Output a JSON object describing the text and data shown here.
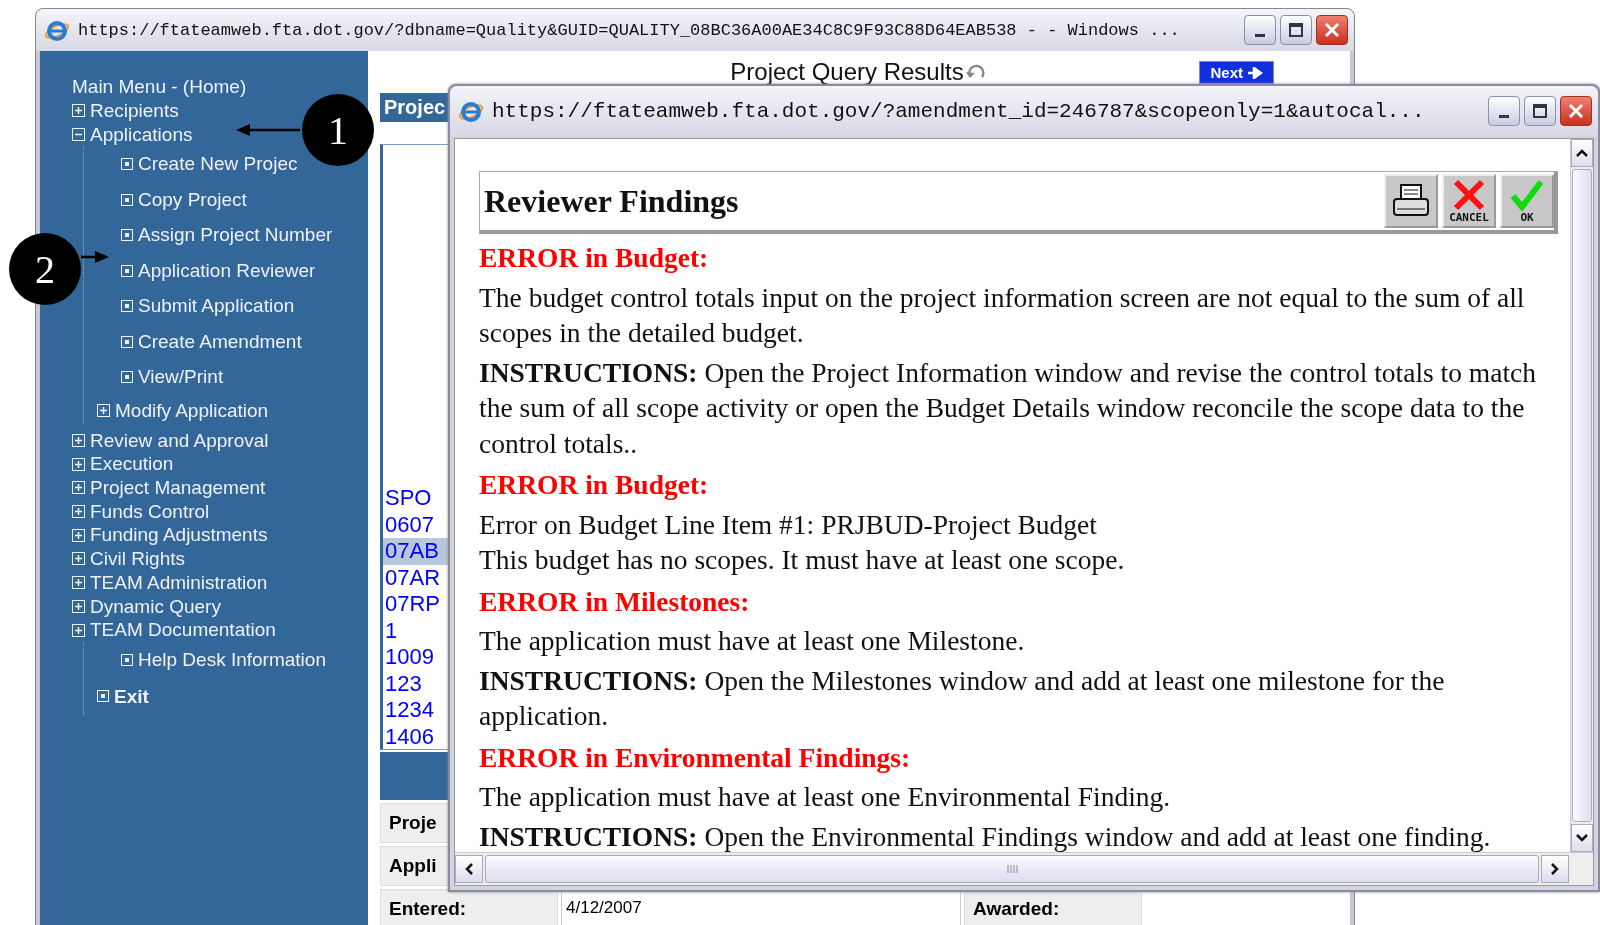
{
  "main_window": {
    "title": "https://ftateamweb.fta.dot.gov/?dbname=Quality&GUID=QUALITY_08BC36A00AE34C8C9F93C88D64EAB538 -  - Windows ...",
    "page_title": "Project Query Results",
    "next_button": "Next",
    "tab_label": "Projec",
    "results": [
      {
        "text": "SPO",
        "selected": false
      },
      {
        "text": "0607",
        "selected": false
      },
      {
        "text": "07AB",
        "selected": true
      },
      {
        "text": "07AR",
        "selected": false
      },
      {
        "text": "07RP",
        "selected": false
      },
      {
        "text": "1",
        "selected": false
      },
      {
        "text": "1009",
        "selected": false
      },
      {
        "text": "123",
        "selected": false
      },
      {
        "text": "1234",
        "selected": false
      },
      {
        "text": "1406",
        "selected": false
      }
    ],
    "form": [
      {
        "label": "Proje"
      },
      {
        "label": "Appli"
      },
      {
        "label": "Entered:",
        "value": "4/12/2007",
        "label_2": "Awarded:"
      }
    ]
  },
  "sidebar": {
    "title": "Main Menu - (Home)",
    "items": [
      {
        "label": "Recipients",
        "kind": "folder",
        "expanded": false
      },
      {
        "label": "Applications",
        "kind": "folder",
        "expanded": true,
        "children": [
          {
            "label": "Create New Projec",
            "kind": "page"
          },
          {
            "label": "Copy Project",
            "kind": "page"
          },
          {
            "label": "Assign Project Number",
            "kind": "page"
          },
          {
            "label": "Application Reviewer",
            "kind": "page"
          },
          {
            "label": "Submit Application",
            "kind": "page"
          },
          {
            "label": "Create Amendment",
            "kind": "page"
          },
          {
            "label": "View/Print",
            "kind": "page"
          },
          {
            "label": "Modify Application",
            "kind": "folder",
            "expanded": false
          }
        ]
      },
      {
        "label": "Review and Approval",
        "kind": "folder",
        "expanded": false
      },
      {
        "label": "Execution",
        "kind": "folder",
        "expanded": false
      },
      {
        "label": "Project Management",
        "kind": "folder",
        "expanded": false
      },
      {
        "label": "Funds Control",
        "kind": "folder",
        "expanded": false
      },
      {
        "label": "Funding Adjustments",
        "kind": "folder",
        "expanded": false
      },
      {
        "label": "Civil Rights",
        "kind": "folder",
        "expanded": false
      },
      {
        "label": "TEAM Administration",
        "kind": "folder",
        "expanded": false
      },
      {
        "label": "Dynamic Query",
        "kind": "folder",
        "expanded": false
      },
      {
        "label": "TEAM Documentation",
        "kind": "folder",
        "expanded": false,
        "children": [
          {
            "label": "Help Desk Information",
            "kind": "page"
          },
          {
            "label": "Exit",
            "kind": "command"
          }
        ]
      }
    ]
  },
  "popup": {
    "title": "https://ftateamweb.fta.dot.gov/?amendment_id=246787&scopeonly=1&autocal...",
    "heading": "Reviewer Findings",
    "toolbar": [
      {
        "kind": "print"
      },
      {
        "kind": "cancel",
        "label": "CANCEL"
      },
      {
        "kind": "ok",
        "label": "OK"
      }
    ],
    "findings": [
      {
        "kind": "error",
        "text": "ERROR in Budget:"
      },
      {
        "kind": "message",
        "text": "The budget control totals input on the project information screen are not equal to the sum of all scopes in the detailed budget."
      },
      {
        "kind": "message",
        "text": "**INSTRUCTIONS:** Open the Project Information window and revise the control totals to match the sum of all scope activity or open the Budget Details window reconcile the scope data to the control totals.."
      },
      {
        "kind": "error",
        "text": "ERROR in Budget:"
      },
      {
        "kind": "line",
        "text": "Error on Budget Line Item #1: PRJBUD-Project Budget"
      },
      {
        "kind": "message",
        "text": "This budget has no scopes. It must have at least one scope."
      },
      {
        "kind": "error",
        "text": "ERROR in Milestones:"
      },
      {
        "kind": "message",
        "text": "The application must have at least one Milestone."
      },
      {
        "kind": "message",
        "text": "**INSTRUCTIONS:** Open the Milestones window and add at least one milestone for the application."
      },
      {
        "kind": "error",
        "text": "ERROR in Environmental Findings:"
      },
      {
        "kind": "message",
        "text": "The application must have at least one Environmental Finding."
      },
      {
        "kind": "message",
        "text": "**INSTRUCTIONS:** Open the Environmental Findings window and add at least one finding."
      }
    ]
  },
  "callouts": [
    {
      "label": "1"
    },
    {
      "label": "2"
    }
  ]
}
